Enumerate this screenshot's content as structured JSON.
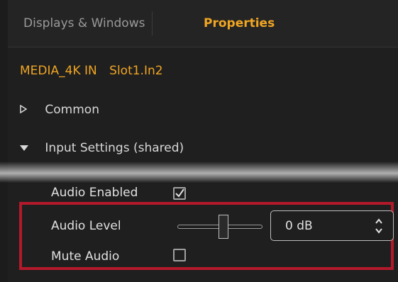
{
  "tabs": {
    "displays_label": "Displays & Windows",
    "properties_label": "Properties"
  },
  "source": {
    "name": "MEDIA_4K IN",
    "slot": "Slot1.In2"
  },
  "tree": {
    "common_label": "Common",
    "input_settings_label": "Input Settings (shared)"
  },
  "settings": {
    "audio_enabled_label": "Audio Enabled",
    "audio_enabled_checked": true,
    "audio_level_label": "Audio Level",
    "audio_level_value": "0 dB",
    "audio_level_slider_fraction": 0.55,
    "mute_audio_label": "Mute Audio",
    "mute_audio_checked": false
  },
  "colors": {
    "accent": "#f0a623",
    "highlight": "#b3192b",
    "background": "#1f1f1f"
  },
  "icons": {
    "collapsed": "triangle-right-icon",
    "expanded": "triangle-down-icon",
    "checkmark": "checkmark-icon",
    "spin": "spin-arrows-icon"
  }
}
